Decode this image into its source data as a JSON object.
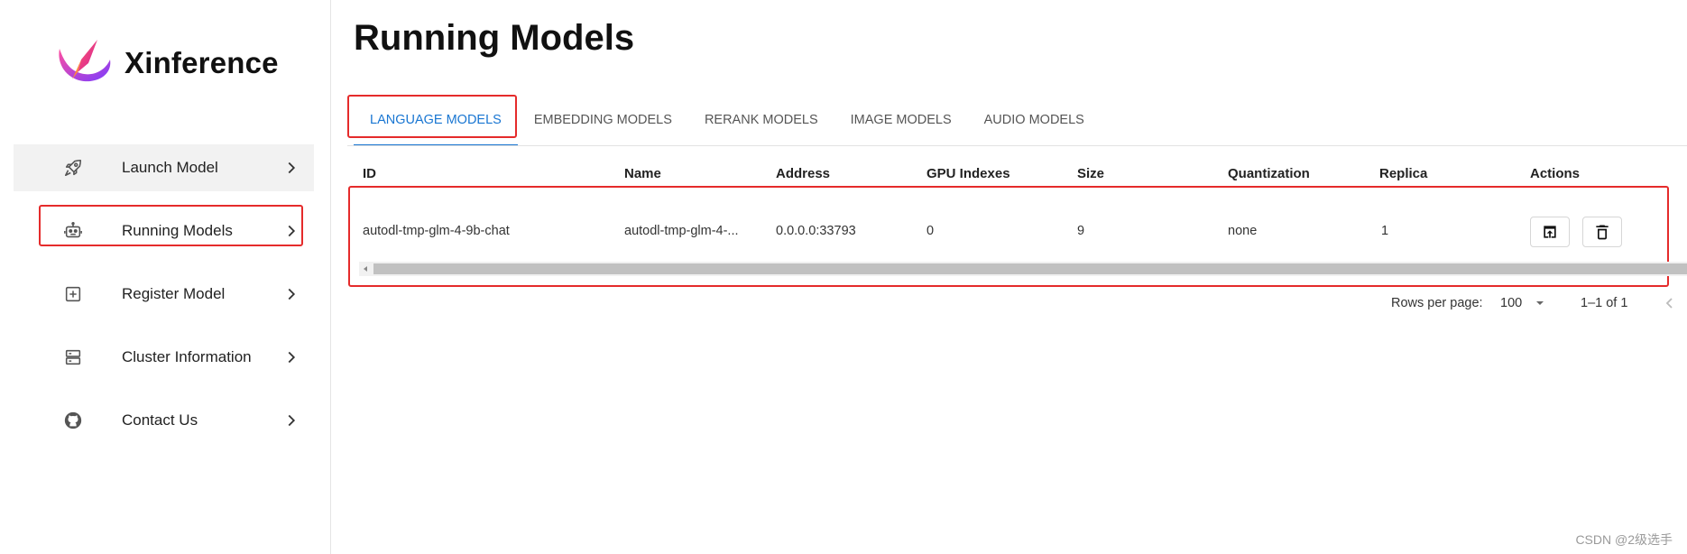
{
  "app": {
    "name": "Xinference"
  },
  "sidebar": {
    "items": [
      {
        "label": "Launch Model",
        "icon": "rocket-icon"
      },
      {
        "label": "Running Models",
        "icon": "robot-icon"
      },
      {
        "label": "Register Model",
        "icon": "plus-square-icon"
      },
      {
        "label": "Cluster Information",
        "icon": "server-icon"
      },
      {
        "label": "Contact Us",
        "icon": "github-icon"
      }
    ]
  },
  "page": {
    "title": "Running Models"
  },
  "tabs": [
    {
      "label": "LANGUAGE MODELS"
    },
    {
      "label": "EMBEDDING MODELS"
    },
    {
      "label": "RERANK MODELS"
    },
    {
      "label": "IMAGE MODELS"
    },
    {
      "label": "AUDIO MODELS"
    }
  ],
  "table": {
    "columns": [
      "ID",
      "Name",
      "Address",
      "GPU Indexes",
      "Size",
      "Quantization",
      "Replica",
      "Actions"
    ],
    "rows": [
      {
        "id": "autodl-tmp-glm-4-9b-chat",
        "name": "autodl-tmp-glm-4-...",
        "address": "0.0.0.0:33793",
        "gpu_indexes": "0",
        "size": "9",
        "quantization": "none",
        "replica": "1",
        "actions": [
          "open-in-new-icon",
          "delete-icon"
        ]
      }
    ]
  },
  "pagination": {
    "rows_per_page_label": "Rows per page:",
    "rows_per_page": "100",
    "range": "1–1 of 1"
  },
  "watermark": "CSDN @2级选手",
  "colors": {
    "accent": "#1976d2",
    "highlight_box": "#e52b2b",
    "active_nav_bg": "#f2f2f2"
  }
}
